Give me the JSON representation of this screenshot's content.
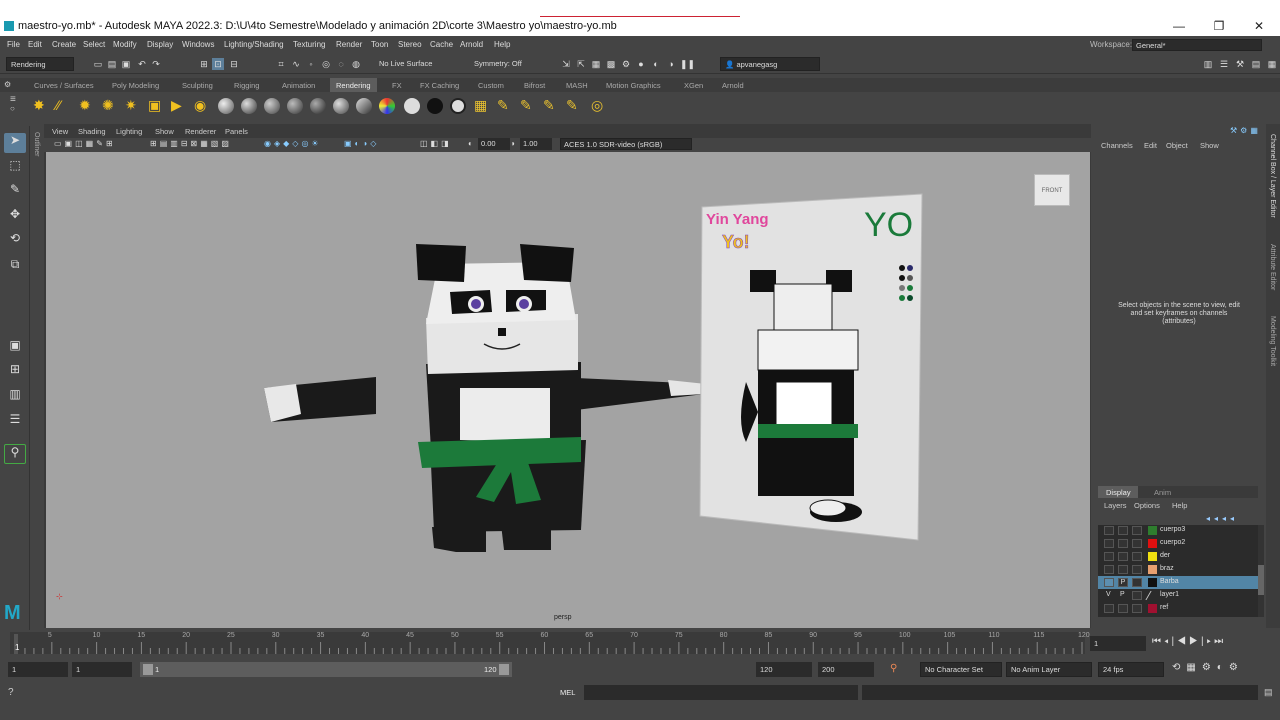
{
  "window": {
    "title": "maestro-yo.mb* - Autodesk MAYA 2022.3: D:\\U\\4to Semestre\\Modelado y animación 2D\\corte 3\\Maestro yo\\maestro-yo.mb",
    "minimize": "—",
    "maximize": "❐",
    "close": "✕"
  },
  "menubar": {
    "items": [
      "File",
      "Edit",
      "Create",
      "Select",
      "Modify",
      "Display",
      "Windows",
      "Lighting/Shading",
      "Texturing",
      "Render",
      "Toon",
      "Stereo",
      "Cache",
      "Arnold",
      "Help"
    ],
    "workspace_label": "Workspace:",
    "workspace_value": "General*"
  },
  "statusline": {
    "menuset": "Rendering",
    "live_surface": "No Live Surface",
    "symmetry": "Symmetry: Off",
    "user": "apvanegasg"
  },
  "shelf": {
    "tabs": [
      "Curves / Surfaces",
      "Poly Modeling",
      "Sculpting",
      "Rigging",
      "Animation",
      "Rendering",
      "FX",
      "FX Caching",
      "Custom",
      "Bifrost",
      "MASH",
      "Motion Graphics",
      "XGen",
      "Arnold"
    ],
    "active_tab": "Rendering"
  },
  "viewport": {
    "menus": [
      "View",
      "Shading",
      "Lighting",
      "Show",
      "Renderer",
      "Panels"
    ],
    "exposure": "0.00",
    "gamma": "1.00",
    "color_space": "ACES 1.0 SDR-video (sRGB)",
    "camera_label": "persp",
    "viewcube_label": "FRONT",
    "poster_title": "YO",
    "logo_line1": "Yin Yang",
    "logo_line2": "Yo!",
    "outliner_label": "Outliner"
  },
  "channel_box": {
    "menus": [
      "Channels",
      "Edit",
      "Object",
      "Show"
    ],
    "message": "Select objects in the scene to view, edit and set keyframes on channels (attributes)"
  },
  "side_tabs": [
    "Channel Box / Layer Editor",
    "Attribute Editor",
    "Modeling Toolkit"
  ],
  "layer_editor": {
    "tabs": [
      "Display",
      "Anim"
    ],
    "menus": [
      "Layers",
      "Options",
      "Help"
    ],
    "layers": [
      {
        "name": "cuerpo3",
        "color": "#2e7d2e",
        "v": "",
        "p": ""
      },
      {
        "name": "cuerpo2",
        "color": "#e01010",
        "v": "",
        "p": ""
      },
      {
        "name": "der",
        "color": "#f0e010",
        "v": "",
        "p": ""
      },
      {
        "name": "braz",
        "color": "#e8a070",
        "v": "",
        "p": ""
      },
      {
        "name": "Barba",
        "color": "#111111",
        "v": "",
        "p": "P",
        "selected": true
      },
      {
        "name": "layer1",
        "color": "",
        "v": "V",
        "p": "P"
      },
      {
        "name": "ref",
        "color": "#a01030",
        "v": "",
        "p": ""
      }
    ]
  },
  "timeline": {
    "ticks": [
      "5",
      "10",
      "15",
      "20",
      "25",
      "30",
      "35",
      "40",
      "45",
      "50",
      "55",
      "60",
      "65",
      "70",
      "75",
      "80",
      "85",
      "90",
      "95",
      "100",
      "105",
      "110",
      "115",
      "120"
    ],
    "current_frame": "1",
    "current_frame_field": "1"
  },
  "range": {
    "start": "1",
    "anim_start": "1",
    "range_start": "1",
    "range_end": "120",
    "end": "120",
    "anim_end": "200",
    "character_set": "No Character Set",
    "anim_layer": "No Anim Layer",
    "fps": "24 fps"
  },
  "command_line": {
    "language": "MEL"
  }
}
